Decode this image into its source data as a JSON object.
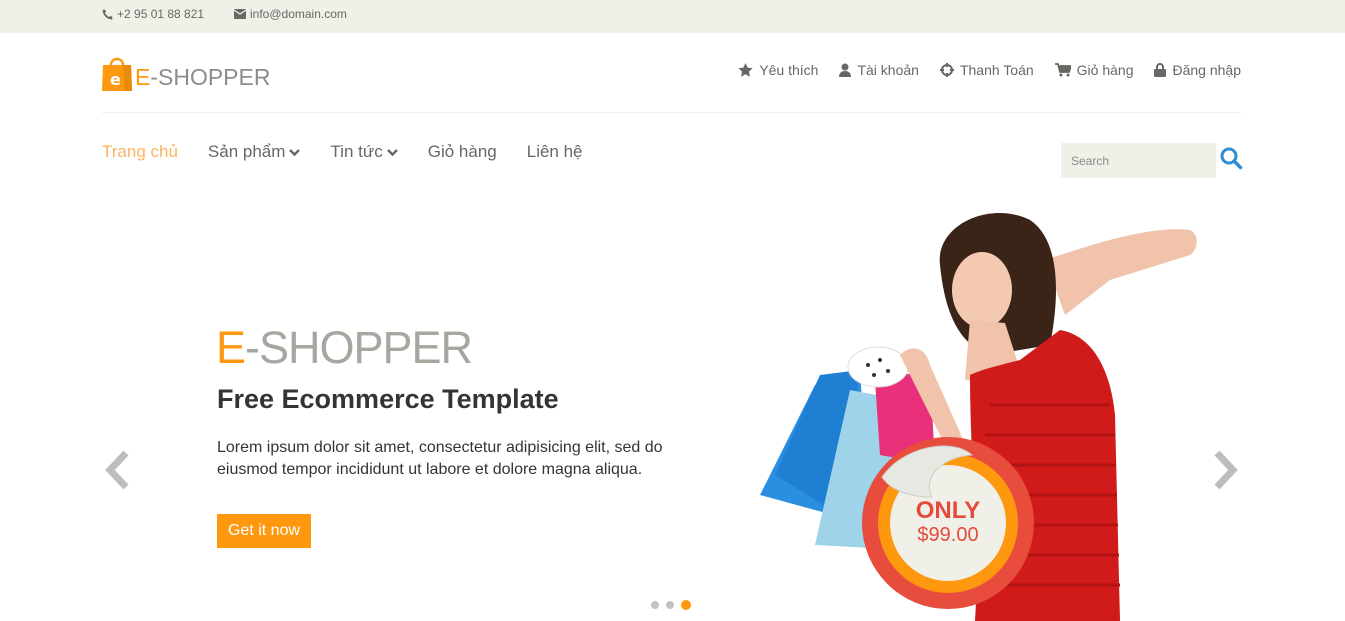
{
  "topbar": {
    "phone": "+2 95 01 88 821",
    "email": "info@domain.com",
    "phone_icon": "phone-icon",
    "email_icon": "envelope-icon"
  },
  "logo": {
    "letter": "e",
    "brand_first": "E",
    "brand_rest": "-SHOPPER"
  },
  "usernav": [
    {
      "label": "Yêu thích",
      "icon": "star-icon"
    },
    {
      "label": "Tài khoản",
      "icon": "user-icon"
    },
    {
      "label": "Thanh Toán",
      "icon": "crosshairs-icon"
    },
    {
      "label": "Giỏ hàng",
      "icon": "cart-icon"
    },
    {
      "label": "Đăng nhập",
      "icon": "lock-icon"
    }
  ],
  "mainnav": [
    {
      "label": "Trang chủ",
      "active": true
    },
    {
      "label": "Sản phẩm",
      "dropdown": true
    },
    {
      "label": "Tin tức",
      "dropdown": true
    },
    {
      "label": "Giỏ hàng"
    },
    {
      "label": "Liên hệ"
    }
  ],
  "search": {
    "placeholder": "Search"
  },
  "slider": {
    "title_first": "E",
    "title_rest": "-SHOPPER",
    "subtitle": "Free Ecommerce Template",
    "description": "Lorem ipsum dolor sit amet, consectetur adipisicing elit, sed do eiusmod tempor incididunt ut labore et dolore magna aliqua.",
    "button": "Get it now",
    "badge_only": "ONLY",
    "badge_price": "$99.00",
    "slides_count": 3,
    "active_slide": 3
  },
  "colors": {
    "accent": "#fe980f",
    "topbar_bg": "#f0f0e9",
    "text": "#696763",
    "badge_red": "#e44b3a"
  }
}
